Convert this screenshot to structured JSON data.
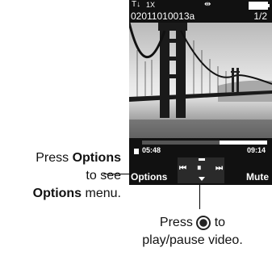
{
  "status": {
    "signal": "T↓",
    "network": "1X",
    "volume": "⇹"
  },
  "player": {
    "filename": "02011010013a",
    "count": "1/2",
    "time_elapsed": "05:48",
    "time_total": "09:14",
    "progress": 0.62,
    "controls": {
      "prev": "⏮",
      "pause": "⏸",
      "next": "⏭"
    }
  },
  "softkeys": {
    "left": "Options",
    "right": "Mute"
  },
  "callouts": {
    "options_pre": "Press ",
    "options_bold": "Options",
    "options_mid": " to see",
    "options_bold2": "Options",
    "options_post": " menu.",
    "center_pre": "Press ",
    "center_post": " to",
    "center_line2": "play/pause video."
  }
}
